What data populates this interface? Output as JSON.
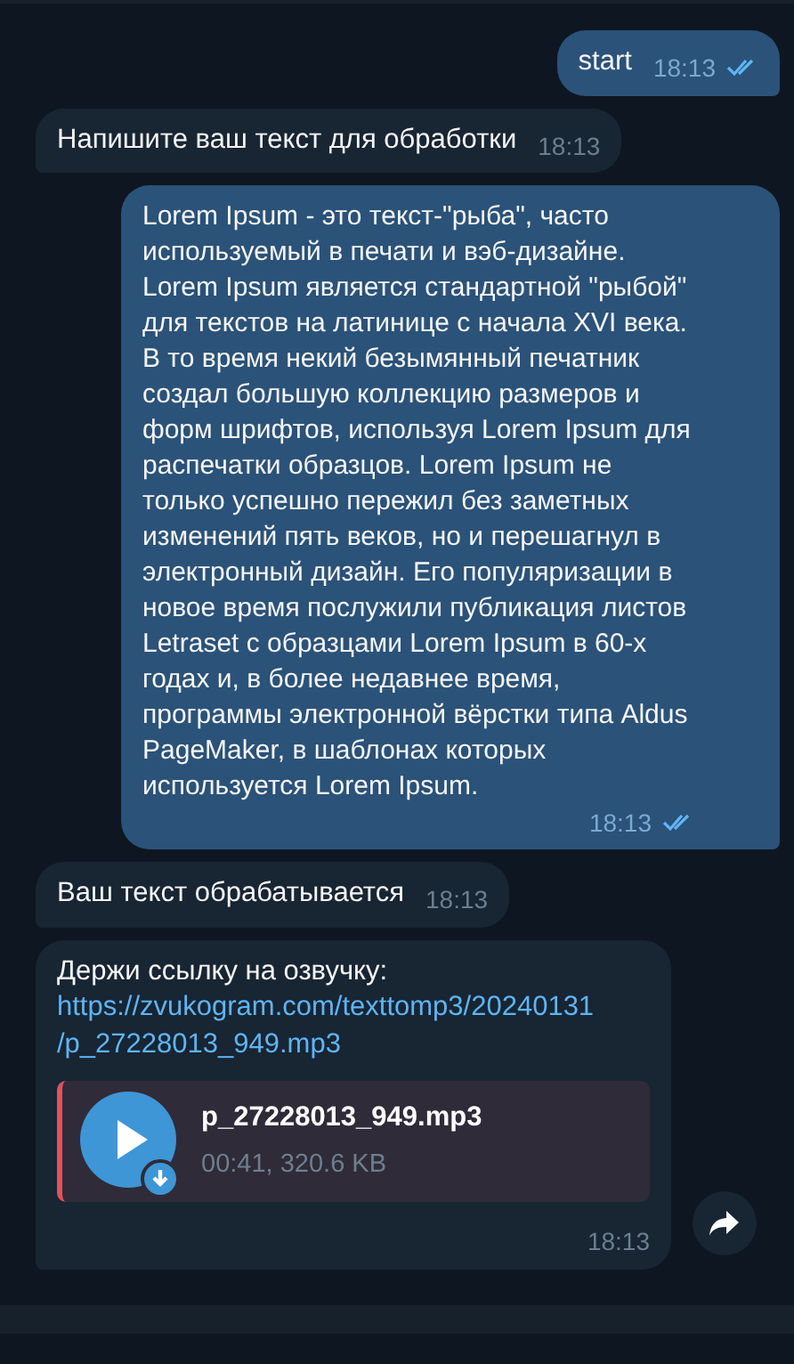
{
  "messages": [
    {
      "kind": "text",
      "outgoing": true,
      "text": "start",
      "time": "18:13",
      "read": true
    },
    {
      "kind": "text",
      "outgoing": false,
      "text": "Напишите ваш текст для обработки",
      "time": "18:13",
      "read": false
    },
    {
      "kind": "text",
      "outgoing": true,
      "text": "Lorem Ipsum - это текст-\"рыба\", часто используемый в печати и вэб-дизайне. Lorem Ipsum является стандартной \"рыбой\" для текстов на латинице с начала XVI века. В то время некий безымянный печатник создал большую коллекцию размеров и форм шрифтов, используя Lorem Ipsum для распечатки образцов. Lorem Ipsum не только успешно пережил без заметных изменений пять веков, но и перешагнул в электронный дизайн. Его популяризации в новое время послужили публикация листов Letraset с образцами Lorem Ipsum в 60-х годах и, в более недавнее время, программы электронной вёрстки типа Aldus PageMaker, в шаблонах которых используется Lorem Ipsum.",
      "time": "18:13",
      "read": true
    },
    {
      "kind": "text",
      "outgoing": false,
      "text": "Ваш текст обрабатывается",
      "time": "18:13",
      "read": false
    },
    {
      "kind": "file",
      "outgoing": false,
      "text": "Держи ссылку на озвучку:",
      "link": [
        "https://zvukogram.com/texttomp3/20240131",
        "/p_27228013_949.mp3"
      ],
      "file_name": "p_27228013_949.mp3",
      "file_info": "00:41, 320.6 KB",
      "time": "18:13",
      "read": false
    }
  ]
}
